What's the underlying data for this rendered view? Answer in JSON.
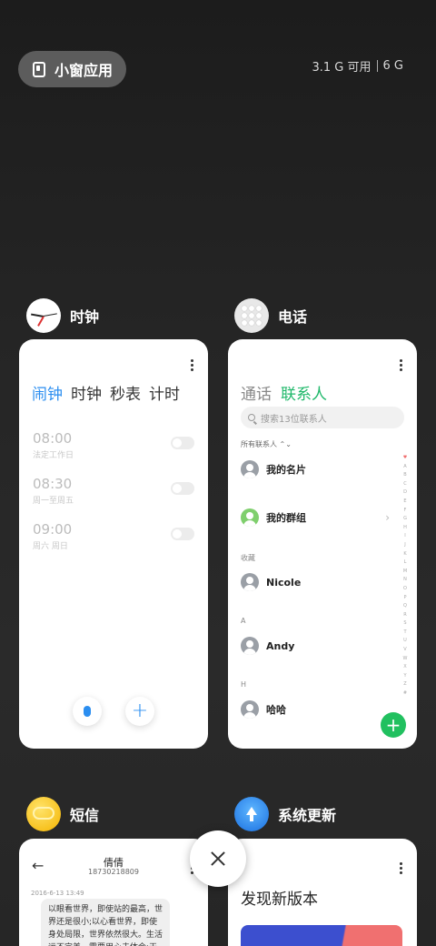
{
  "top": {
    "small_window_label": "小窗应用",
    "memory_available": "3.1 G 可用",
    "memory_total": "6 G"
  },
  "apps": {
    "clock": {
      "name": "时钟",
      "tabs": [
        "闹钟",
        "时钟",
        "秒表",
        "计时"
      ],
      "active_tab": 0,
      "alarms": [
        {
          "time": "08:00",
          "days": "法定工作日"
        },
        {
          "time": "08:30",
          "days": "周一至周五"
        },
        {
          "time": "09:00",
          "days": "周六 周日"
        }
      ]
    },
    "phone": {
      "name": "电话",
      "tabs": [
        "通话",
        "联系人"
      ],
      "active_tab": 1,
      "search_placeholder": "搜索13位联系人",
      "all_contacts": "所有联系人 ⌃⌄",
      "my_card": "我的名片",
      "my_groups": "我的群组",
      "section_fav": "收藏",
      "contact_nicole": "Nicole",
      "section_a": "A",
      "contact_andy": "Andy",
      "section_h": "H",
      "contact_haha": "哈哈",
      "index_letters": [
        "♥",
        "A",
        "B",
        "C",
        "D",
        "E",
        "F",
        "G",
        "H",
        "I",
        "J",
        "K",
        "L",
        "M",
        "N",
        "O",
        "P",
        "Q",
        "R",
        "S",
        "T",
        "U",
        "V",
        "W",
        "X",
        "Y",
        "Z",
        "#"
      ]
    },
    "sms": {
      "name": "短信",
      "contact_name": "倩倩",
      "contact_number": "18730218809",
      "date": "2016-6-13 13:49",
      "message": "以眼看世界，即使站的最高，世界还是很小;以心看世界，即使身处局限，世界依然很大。生活远不完美，需要用心去体会;天需要有走"
    },
    "update": {
      "name": "系统更新",
      "title": "发现新版本"
    }
  },
  "colors": {
    "clock_accent": "#2b8ef0",
    "contacts_accent": "#1fb86a"
  }
}
